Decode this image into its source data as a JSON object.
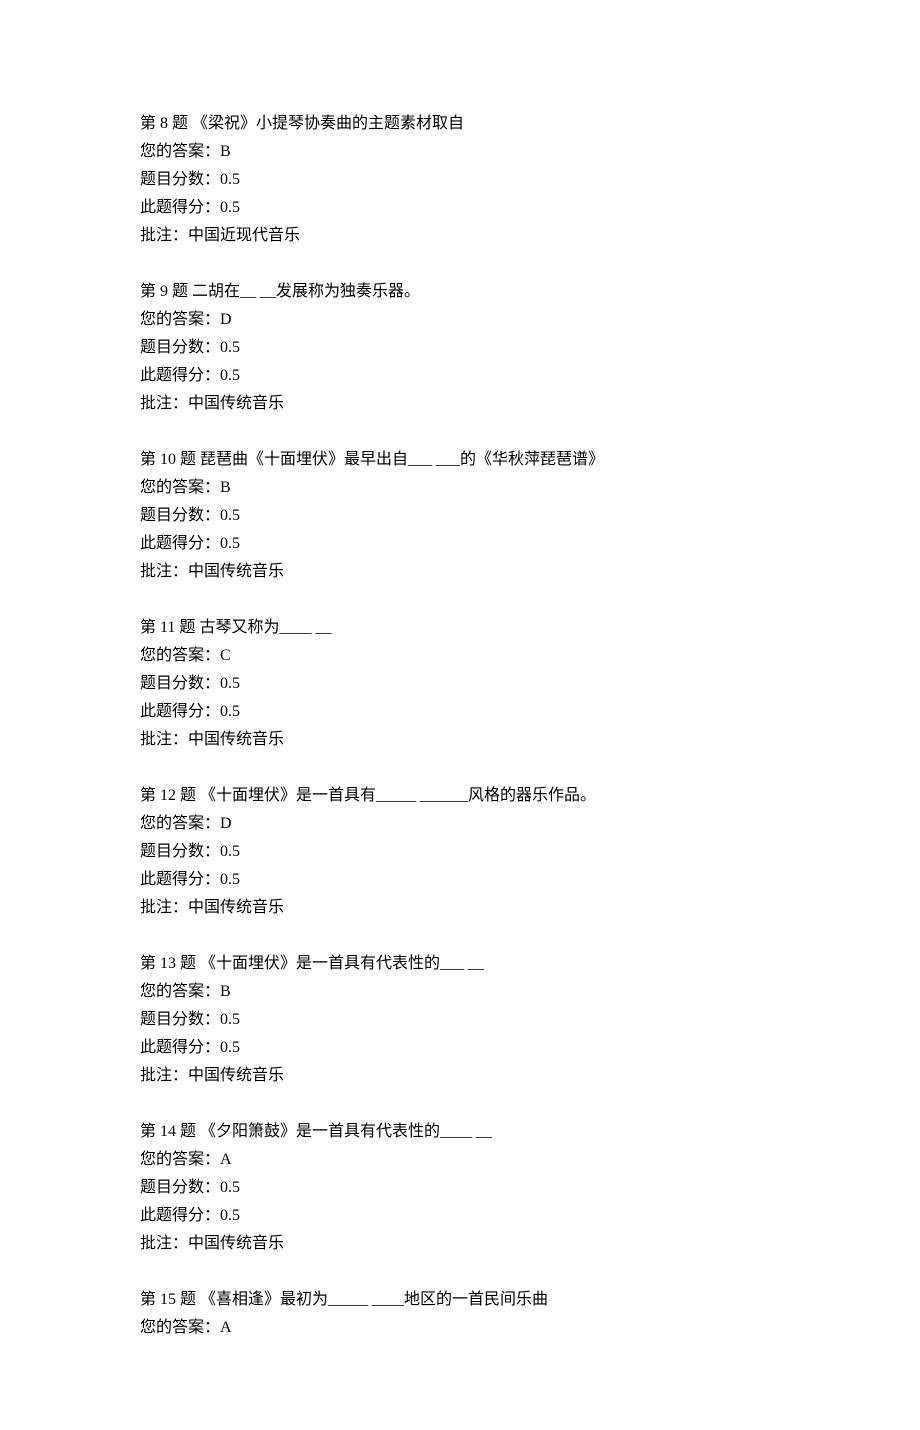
{
  "labels": {
    "question_prefix": "第",
    "question_suffix": "题",
    "your_answer": "您的答案：",
    "question_score": "题目分数：",
    "earned_score": "此题得分：",
    "note": "批注："
  },
  "questions": [
    {
      "number": "8",
      "text": " 《梁祝》小提琴协奏曲的主题素材取自",
      "answer": "B",
      "score": "0.5",
      "earned": "0.5",
      "note_text": "中国近现代音乐"
    },
    {
      "number": "9",
      "text": "  二胡在__ __发展称为独奏乐器。",
      "answer": "D",
      "score": "0.5",
      "earned": "0.5",
      "note_text": "中国传统音乐"
    },
    {
      "number": "10",
      "text": "  琵琶曲《十面埋伏》最早出自___ ___的《华秋萍琵琶谱》",
      "answer": "B",
      "score": "0.5",
      "earned": "0.5",
      "note_text": "中国传统音乐"
    },
    {
      "number": "11",
      "text": "  古琴又称为____ __",
      "answer": "C",
      "score": "0.5",
      "earned": "0.5",
      "note_text": "中国传统音乐"
    },
    {
      "number": "12",
      "text": " 《十面埋伏》是一首具有_____ ______风格的器乐作品。",
      "answer": "D",
      "score": "0.5",
      "earned": "0.5",
      "note_text": "中国传统音乐"
    },
    {
      "number": "13",
      "text": " 《十面埋伏》是一首具有代表性的___ __",
      "answer": "B",
      "score": "0.5",
      "earned": "0.5",
      "note_text": "中国传统音乐"
    },
    {
      "number": "14",
      "text": " 《夕阳箫鼓》是一首具有代表性的____ __",
      "answer": "A",
      "score": "0.5",
      "earned": "0.5",
      "note_text": "中国传统音乐"
    },
    {
      "number": "15",
      "text": " 《喜相逢》最初为_____ ____地区的一首民间乐曲",
      "answer": "A",
      "score": "",
      "earned": "",
      "note_text": "",
      "partial": true
    }
  ]
}
